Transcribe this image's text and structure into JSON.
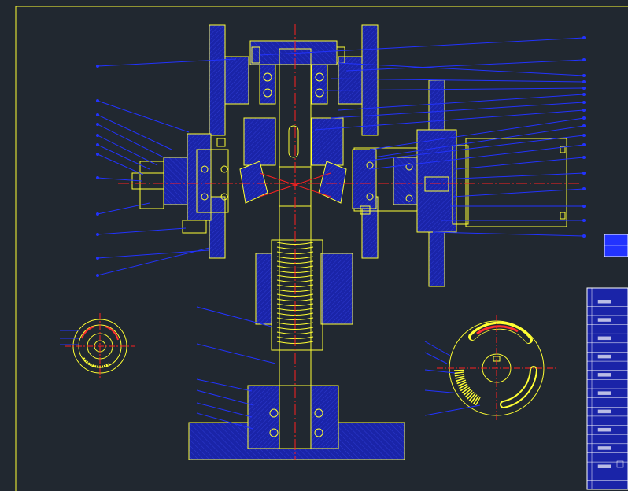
{
  "drawing": {
    "background_color": "#212830",
    "line_color": "#ffff33",
    "leader_color": "#2233ff",
    "hatch_color": "#1a24a8",
    "centerline_color": "#ff2020",
    "white_color": "#ffffff",
    "leader_count_left": 12,
    "leader_count_right": 18,
    "title_block_rows": 22,
    "parts_list_rows": 6
  }
}
